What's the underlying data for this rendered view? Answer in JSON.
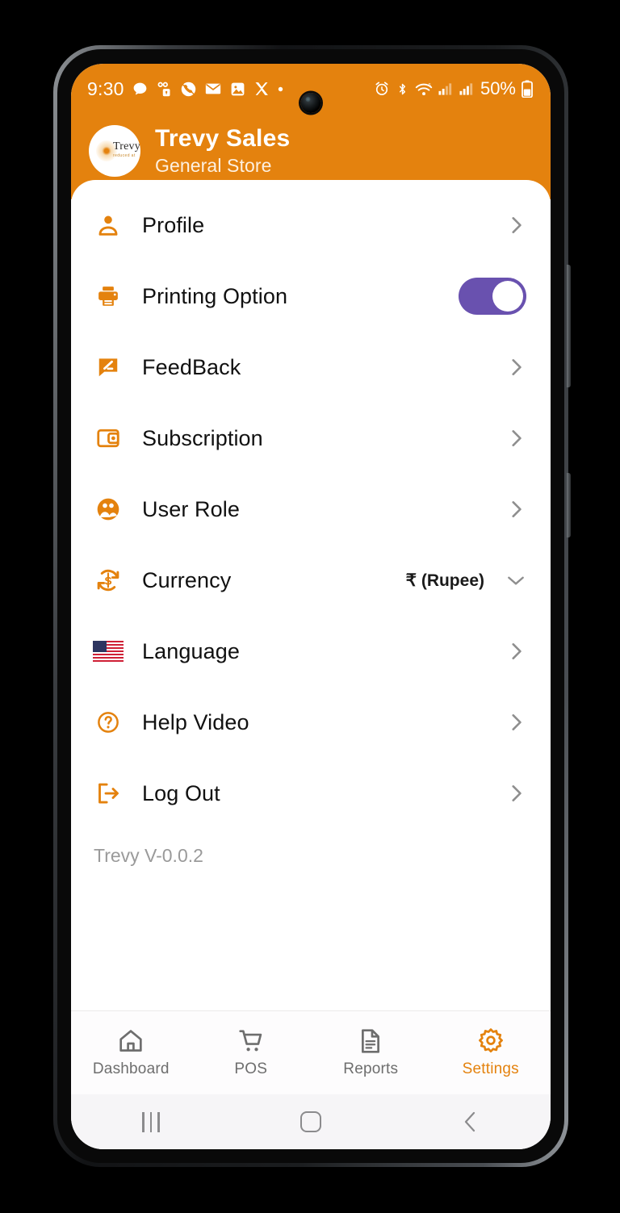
{
  "colors": {
    "brand_orange": "#e4820e",
    "toggle_purple": "#6951af",
    "chevron_gray": "#8e8e8e",
    "nav_inactive": "#6e6e6e"
  },
  "status_bar": {
    "time": "9:30",
    "battery_percent": "50%",
    "left_icons": [
      "chat-bubble-icon",
      "voicemail-icon",
      "phone-circle-icon",
      "mail-icon",
      "photos-icon",
      "x-app-icon",
      "more-dot-icon"
    ],
    "right_icons": [
      "alarm-icon",
      "bluetooth-icon",
      "wifi-icon",
      "signal-bars-icon",
      "signal-bars-icon-2",
      "battery-icon"
    ]
  },
  "header": {
    "title": "Trevy Sales",
    "subtitle": "General Store",
    "logo_word": "Trevy",
    "logo_tagline": "reduced at"
  },
  "menu": {
    "items": [
      {
        "label": "Profile",
        "icon": "person-icon",
        "trailing": "chevron-right",
        "value": ""
      },
      {
        "label": "Printing Option",
        "icon": "printer-icon",
        "trailing": "toggle",
        "value": "",
        "toggle_on": true
      },
      {
        "label": "FeedBack",
        "icon": "feedback-icon",
        "trailing": "chevron-right",
        "value": ""
      },
      {
        "label": "Subscription",
        "icon": "wallet-icon",
        "trailing": "chevron-right",
        "value": ""
      },
      {
        "label": "User Role",
        "icon": "users-icon",
        "trailing": "chevron-right",
        "value": ""
      },
      {
        "label": "Currency",
        "icon": "currency-exchange-icon",
        "trailing": "chevron-down",
        "value": "₹ (Rupee)"
      },
      {
        "label": "Language",
        "icon": "flag-us-icon",
        "trailing": "chevron-right",
        "value": ""
      },
      {
        "label": "Help Video",
        "icon": "help-circle-icon",
        "trailing": "chevron-right",
        "value": ""
      },
      {
        "label": "Log Out",
        "icon": "logout-icon",
        "trailing": "chevron-right",
        "value": ""
      }
    ],
    "version": "Trevy V-0.0.2"
  },
  "bottom_nav": {
    "items": [
      {
        "label": "Dashboard",
        "icon": "home-icon",
        "active": false
      },
      {
        "label": "POS",
        "icon": "cart-icon",
        "active": false
      },
      {
        "label": "Reports",
        "icon": "document-icon",
        "active": false
      },
      {
        "label": "Settings",
        "icon": "gear-icon",
        "active": true
      }
    ]
  },
  "system_nav": {
    "recents": "recents-icon",
    "home": "home-square-icon",
    "back": "back-chevron-icon"
  }
}
